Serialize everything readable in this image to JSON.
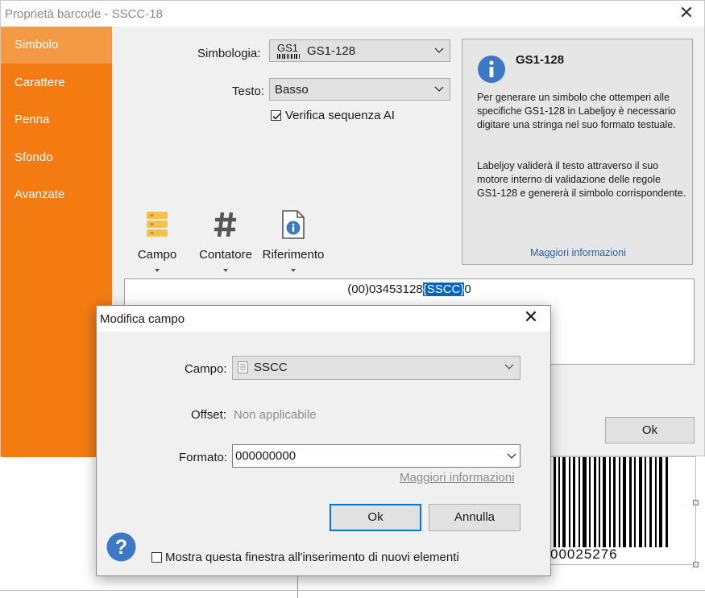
{
  "background": {
    "barcode_digits": "00025276"
  },
  "main_window": {
    "title": "Proprietà barcode - SSCC-18",
    "close_icon": "close-icon",
    "sidebar": {
      "items": [
        {
          "label": "Simbolo",
          "active": true
        },
        {
          "label": "Carattere",
          "active": false
        },
        {
          "label": "Penna",
          "active": false
        },
        {
          "label": "Sfondo",
          "active": false
        },
        {
          "label": "Avanzate",
          "active": false
        }
      ]
    },
    "symbology": {
      "label": "Simbologia:",
      "value": "GS1-128",
      "glyph_text": "GS1"
    },
    "text_option": {
      "label": "Testo:",
      "value": "Basso"
    },
    "verify_ai": {
      "label": "Verifica sequenza AI",
      "checked": true
    },
    "info_panel": {
      "title": "GS1-128",
      "paragraph1": "Per generare un simbolo che ottemperi alle specifiche GS1-128 in Labeljoy è necessario digitare una stringa nel suo formato testuale.",
      "paragraph2": "Labeljoy validerà il testo attraverso il suo motore interno di validazione delle regole GS1-128 e genererà il simbolo corrispondente.",
      "link": "Maggiori informazioni"
    },
    "tools": [
      {
        "label": "Campo",
        "icon": "field-icon"
      },
      {
        "label": "Contatore",
        "icon": "hash-icon"
      },
      {
        "label": "Riferimento",
        "icon": "reference-info-icon"
      }
    ],
    "expression": {
      "prefix": "(00)03453128",
      "selected": "{SSCC}",
      "suffix": "0"
    },
    "ok_label": "Ok"
  },
  "dialog": {
    "title": "Modifica campo",
    "field": {
      "label": "Campo:",
      "value": "SSCC"
    },
    "offset": {
      "label": "Offset:",
      "value": "Non applicabile"
    },
    "format": {
      "label": "Formato:",
      "value": "000000000"
    },
    "more_info_link": "Maggiori informazioni",
    "ok_label": "Ok",
    "cancel_label": "Annulla",
    "show_checkbox": {
      "label": "Mostra questa finestra all'inserimento di nuovi elementi",
      "checked": false
    },
    "accent_color": "#0078d7",
    "help_icon_color": "#3c78c4"
  }
}
